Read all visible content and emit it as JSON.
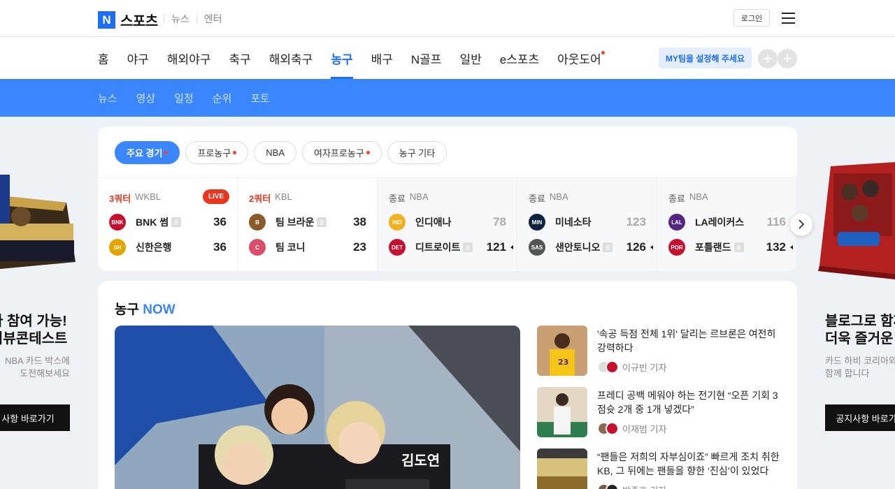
{
  "header": {
    "logo_mark": "N",
    "logo_text": "스포츠",
    "service_links": [
      "뉴스",
      "엔터"
    ],
    "login": "로그인"
  },
  "nav": {
    "items": [
      "홈",
      "야구",
      "해외야구",
      "축구",
      "해외축구",
      "농구",
      "배구",
      "N골프",
      "일반",
      "e스포츠",
      "아웃도어"
    ],
    "active": "농구",
    "myteam": "MY팀을 설정해 주세요",
    "plus": "+"
  },
  "subnav": {
    "items": [
      "뉴스",
      "영상",
      "일정",
      "순위",
      "포토"
    ]
  },
  "chips": [
    {
      "label": "주요 경기",
      "dot": true,
      "active": true
    },
    {
      "label": "프로농구",
      "dot": true,
      "active": false
    },
    {
      "label": "NBA",
      "dot": false,
      "active": false
    },
    {
      "label": "여자프로농구",
      "dot": true,
      "active": false
    },
    {
      "label": "농구 기타",
      "dot": false,
      "active": false
    }
  ],
  "games": [
    {
      "status": "3쿼터",
      "league": "WKBL",
      "live": "LIVE",
      "teams": [
        {
          "name": "BNK 썸",
          "home": "홈",
          "score": "36",
          "logo": "#c8102e",
          "logo_text": "BNK"
        },
        {
          "name": "신한은행",
          "home": "",
          "score": "36",
          "logo": "#e2a500",
          "logo_text": "SH"
        }
      ]
    },
    {
      "status": "2쿼터",
      "league": "KBL",
      "live": "",
      "teams": [
        {
          "name": "팀 브라운",
          "home": "홈",
          "score": "38",
          "logo": "#8b5a2b",
          "logo_text": "B"
        },
        {
          "name": "팀 코니",
          "home": "",
          "score": "23",
          "logo": "#d94f6a",
          "logo_text": "C"
        }
      ]
    },
    {
      "status": "종료",
      "league": "NBA",
      "live": "",
      "teams": [
        {
          "name": "인디애나",
          "home": "",
          "score": "78",
          "logo": "#f2b01e",
          "logo_text": "IND"
        },
        {
          "name": "디트로이트",
          "home": "홈",
          "score": "121",
          "logo": "#c8102e",
          "logo_text": "DET"
        }
      ]
    },
    {
      "status": "종료",
      "league": "NBA",
      "live": "",
      "teams": [
        {
          "name": "미네소타",
          "home": "",
          "score": "123",
          "logo": "#0c2340",
          "logo_text": "MIN"
        },
        {
          "name": "샌안토니오",
          "home": "홈",
          "score": "126",
          "logo": "#555555",
          "logo_text": "SAS"
        }
      ]
    },
    {
      "status": "종료",
      "league": "NBA",
      "live": "",
      "teams": [
        {
          "name": "LA레이커스",
          "home": "",
          "score": "116",
          "logo": "#552583",
          "logo_text": "LAL"
        },
        {
          "name": "포틀랜드",
          "home": "홈",
          "score": "132",
          "logo": "#c8102e",
          "logo_text": "POR"
        }
      ]
    }
  ],
  "ad_left": {
    "title_lines": [
      "나 참여 가능!",
      "리뷰콘테스트"
    ],
    "desc_lines": [
      "NBA 카드 박스에",
      "도전해보세요"
    ],
    "cta": "사항 바로가기"
  },
  "ad_right": {
    "title_lines": [
      "블로그로 함께",
      "더욱 즐거운 스"
    ],
    "desc_lines": [
      "카드 하비 코리아와",
      "함께 합니다"
    ],
    "cta": "공지사항 바로가기"
  },
  "now": {
    "title": "농구",
    "title_accent": "NOW",
    "news": [
      {
        "headline": "'속공 득점 전체 1위' 달리는 르브론은 여전히 강력하다",
        "author": "이규빈 기자"
      },
      {
        "headline": "프레디 공백 메워야 하는 전기현 “오픈 기회 3점슛 2개 중 1개 넣겠다”",
        "author": "이재범 기자"
      },
      {
        "headline": "“팬들은 저희의 자부심이죠” 빠르게 조치 취한 KB, 그 뒤에는 팬들을 향한 ‘진심’이 있었다",
        "author": "박종호 기자"
      }
    ]
  },
  "colors": {
    "accent": "#3a86ff",
    "brand": "#1e6df5",
    "live": "#e8371f"
  }
}
